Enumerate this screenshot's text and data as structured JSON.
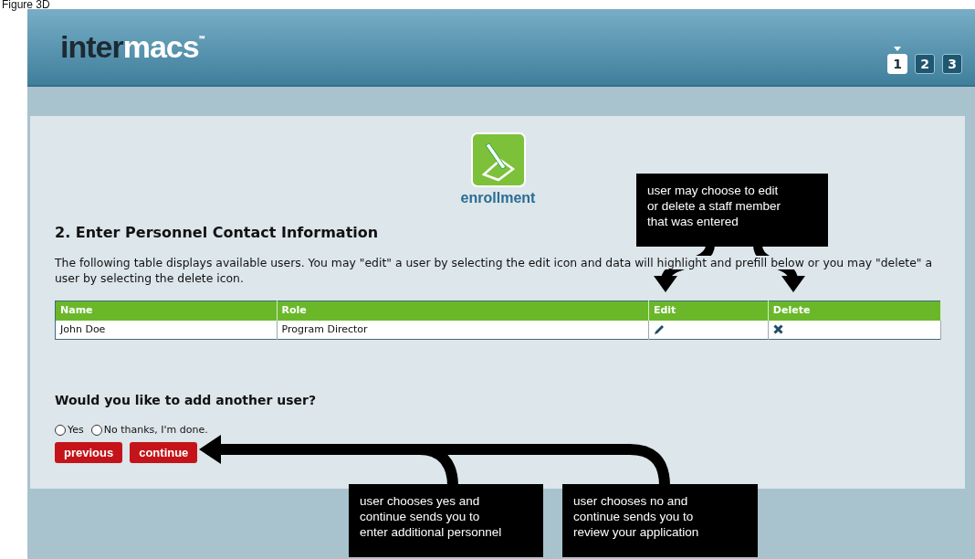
{
  "caption": "Figure 3D",
  "header": {
    "logo_dark": "inter",
    "logo_light": "macs",
    "logo_mark": "℠",
    "steps": [
      {
        "label": "1",
        "selected": true
      },
      {
        "label": "2",
        "selected": false
      },
      {
        "label": "3",
        "selected": false
      }
    ]
  },
  "section": {
    "icon_label": "enrollment",
    "heading": "2. Enter Personnel Contact Information",
    "description": "The following table displays available users. You may \"edit\" a user by selecting the edit icon and data will highlight and prefill below or you may \"delete\" a user by selecting the delete icon.",
    "table": {
      "columns": [
        "Name",
        "Role",
        "Edit",
        "Delete"
      ],
      "rows": [
        {
          "name": "John Doe",
          "role": "Program Director"
        }
      ]
    },
    "question": "Would you like to add another user?",
    "options": [
      {
        "label": "Yes",
        "selected": false
      },
      {
        "label": "No thanks, I'm done.",
        "selected": false
      }
    ],
    "buttons": [
      "previous",
      "continue"
    ]
  },
  "annotations": [
    {
      "text": "user may choose to edit\nor delete a staff member\nthat was entered"
    },
    {
      "text": "user chooses yes and\ncontinue sends you to\nenter additional personnel"
    },
    {
      "text": "user chooses no and\ncontinue sends you to\nreview your application"
    }
  ]
}
